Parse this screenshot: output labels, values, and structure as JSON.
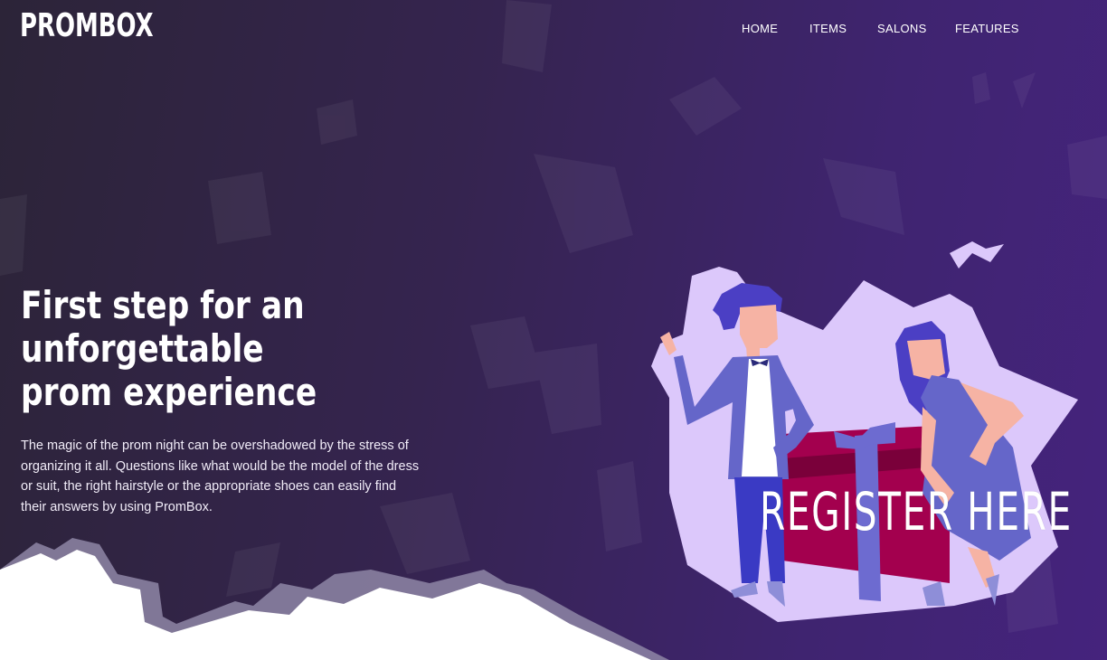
{
  "brand": {
    "logo_text": "PROMBOX"
  },
  "nav": {
    "items": [
      "HOME",
      "ITEMS",
      "SALONS",
      "FEATURES"
    ]
  },
  "hero": {
    "title": "First step for an unforgettable prom experience",
    "description": "The magic of the prom night can be overshadowed by the stress of organizing it all. Questions like what would be the model of the dress or suit, the right hairstyle or the appropriate shoes can easily find their answers by using PromBox."
  },
  "cta": {
    "register_label": "REGISTER HERE"
  },
  "colors": {
    "bg_start": "#2c2438",
    "bg_end": "#45237d",
    "illustration_bg": "#dcc8fb",
    "gift_box": "#a3004e",
    "ribbon": "#6d6bd0",
    "suit": "#6566c9",
    "hair": "#4b3fc4",
    "skin": "#f6b3a4",
    "bottom_cloud": "#ffffff"
  },
  "icons": [
    "couple-illustration",
    "gift-box-illustration",
    "paper-confetti"
  ]
}
